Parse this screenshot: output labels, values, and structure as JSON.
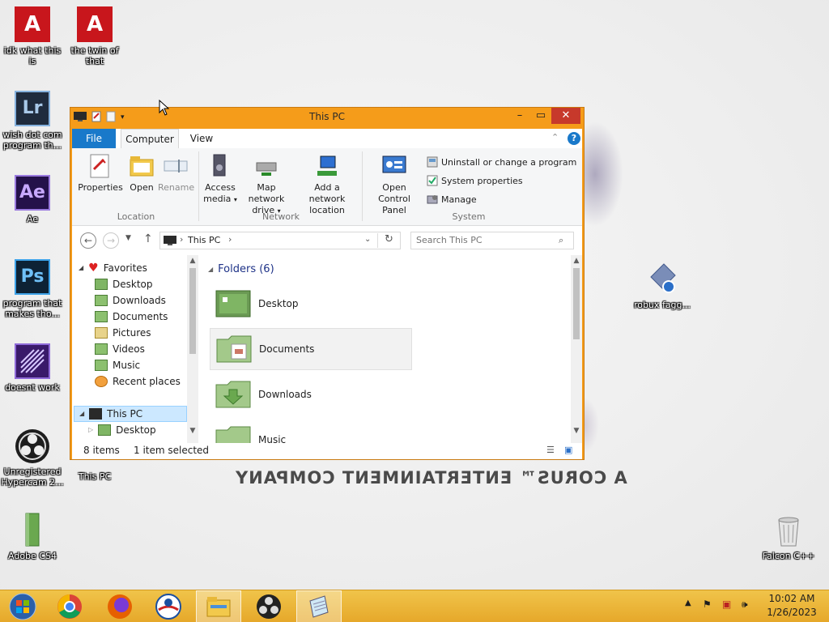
{
  "desktop": {
    "wallpaper_text": "A CORUS™ ENTERTAINMENT COMPANY",
    "icons": [
      {
        "label": "idk what this is"
      },
      {
        "label": "the twin of that"
      },
      {
        "label": "wish dot com program th..."
      },
      {
        "label": "Ae"
      },
      {
        "label": "program that makes tho..."
      },
      {
        "label": "doesnt work"
      },
      {
        "label": "Unregistered Hypercam 2..."
      },
      {
        "label": "This PC"
      },
      {
        "label": "Adobe CS4"
      },
      {
        "label": "robux fagg..."
      },
      {
        "label": "Falcon C++"
      }
    ]
  },
  "window": {
    "title": "This PC",
    "tabs": [
      "File",
      "Computer",
      "View"
    ],
    "ribbon": {
      "location": {
        "label": "Location",
        "buttons": [
          "Properties",
          "Open",
          "Rename"
        ]
      },
      "network": {
        "label": "Network",
        "buttons": [
          "Access media",
          "Map network drive",
          "Add a network location"
        ]
      },
      "system": {
        "label": "System",
        "open_control_panel": "Open Control Panel",
        "items": [
          "Uninstall or change a program",
          "System properties",
          "Manage"
        ]
      }
    },
    "address": {
      "path": "This PC",
      "search_placeholder": "Search This PC"
    },
    "nav": {
      "favorites": "Favorites",
      "favorite_items": [
        "Desktop",
        "Downloads",
        "Documents",
        "Pictures",
        "Videos",
        "Music",
        "Recent places"
      ],
      "this_pc": "This PC",
      "this_pc_child": "Desktop"
    },
    "content": {
      "group_header": "Folders (6)",
      "folders": [
        "Desktop",
        "Documents",
        "Downloads",
        "Music"
      ]
    },
    "status": {
      "items": "8 items",
      "selected": "1 item selected"
    }
  },
  "taskbar": {
    "clock_time": "10:02 AM",
    "clock_date": "1/26/2023"
  },
  "colors": {
    "accent": "#f59c1a",
    "file_tab": "#1979ca",
    "taskbar": "#e8ae30"
  }
}
